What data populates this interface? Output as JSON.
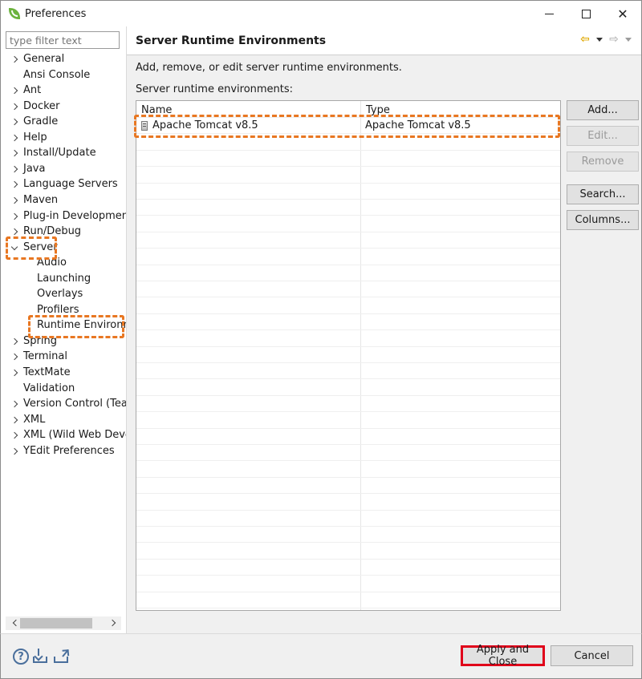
{
  "window": {
    "title": "Preferences",
    "minimize_label": "",
    "maximize_label": "",
    "close_label": "✕"
  },
  "sidebar": {
    "filter_placeholder": "type filter text",
    "items": [
      {
        "label": "General",
        "expandable": true
      },
      {
        "label": "Ansi Console",
        "expandable": false
      },
      {
        "label": "Ant",
        "expandable": true
      },
      {
        "label": "Docker",
        "expandable": true
      },
      {
        "label": "Gradle",
        "expandable": true
      },
      {
        "label": "Help",
        "expandable": true
      },
      {
        "label": "Install/Update",
        "expandable": true
      },
      {
        "label": "Java",
        "expandable": true
      },
      {
        "label": "Language Servers",
        "expandable": true
      },
      {
        "label": "Maven",
        "expandable": true
      },
      {
        "label": "Plug-in Developmen",
        "expandable": true
      },
      {
        "label": "Run/Debug",
        "expandable": true
      },
      {
        "label": "Server",
        "expandable": true,
        "expanded": true
      },
      {
        "label": "Audio",
        "child": true
      },
      {
        "label": "Launching",
        "child": true
      },
      {
        "label": "Overlays",
        "child": true
      },
      {
        "label": "Profilers",
        "child": true
      },
      {
        "label": "Runtime Environn",
        "child": true,
        "selected": true
      },
      {
        "label": "Spring",
        "expandable": true
      },
      {
        "label": "Terminal",
        "expandable": true
      },
      {
        "label": "TextMate",
        "expandable": true
      },
      {
        "label": "Validation",
        "expandable": false
      },
      {
        "label": "Version Control (Tea",
        "expandable": true
      },
      {
        "label": "XML",
        "expandable": true
      },
      {
        "label": "XML (Wild Web Deve",
        "expandable": true
      },
      {
        "label": "YEdit Preferences",
        "expandable": true
      }
    ]
  },
  "page": {
    "title": "Server Runtime Environments",
    "description": "Add, remove, or edit server runtime environments.",
    "list_label": "Server runtime environments:",
    "table": {
      "columns": [
        "Name",
        "Type"
      ],
      "rows": [
        {
          "name": "Apache Tomcat v8.5",
          "type": "Apache Tomcat v8.5"
        }
      ]
    },
    "buttons": {
      "add": "Add...",
      "edit": "Edit...",
      "remove": "Remove",
      "search": "Search...",
      "columns": "Columns..."
    }
  },
  "footer": {
    "help_glyph": "?",
    "apply_close": "Apply and Close",
    "cancel": "Cancel"
  },
  "colors": {
    "highlight_dashed": "#e87722",
    "highlight_solid": "#e0001a",
    "spring_green": "#6db33f"
  }
}
